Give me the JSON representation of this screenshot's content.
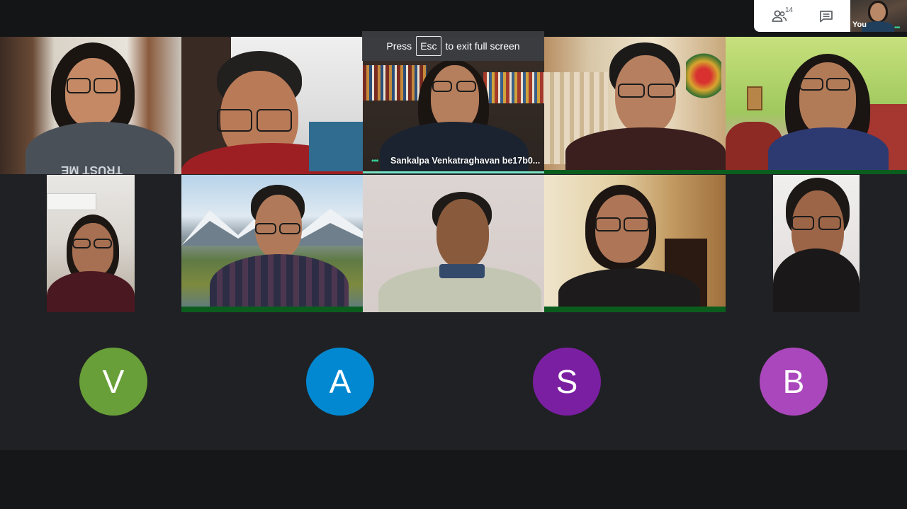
{
  "toast": {
    "press_label": "Press",
    "key_label": "Esc",
    "suffix_label": "to exit full screen"
  },
  "toolbar": {
    "people_count": "14",
    "people_icon": "people-icon",
    "chat_icon": "chat-icon"
  },
  "self_view": {
    "label": "You"
  },
  "active_speaker": {
    "name": "Sankalpa Venkatraghavan be17b0..."
  },
  "avatars": [
    {
      "letter": "V",
      "color": "#689f38"
    },
    {
      "letter": "A",
      "color": "#0288d1"
    },
    {
      "letter": "S",
      "color": "#7b1fa2"
    },
    {
      "letter": "B",
      "color": "#ab47bc"
    }
  ],
  "tile_shirt_text": "TRUST ME"
}
